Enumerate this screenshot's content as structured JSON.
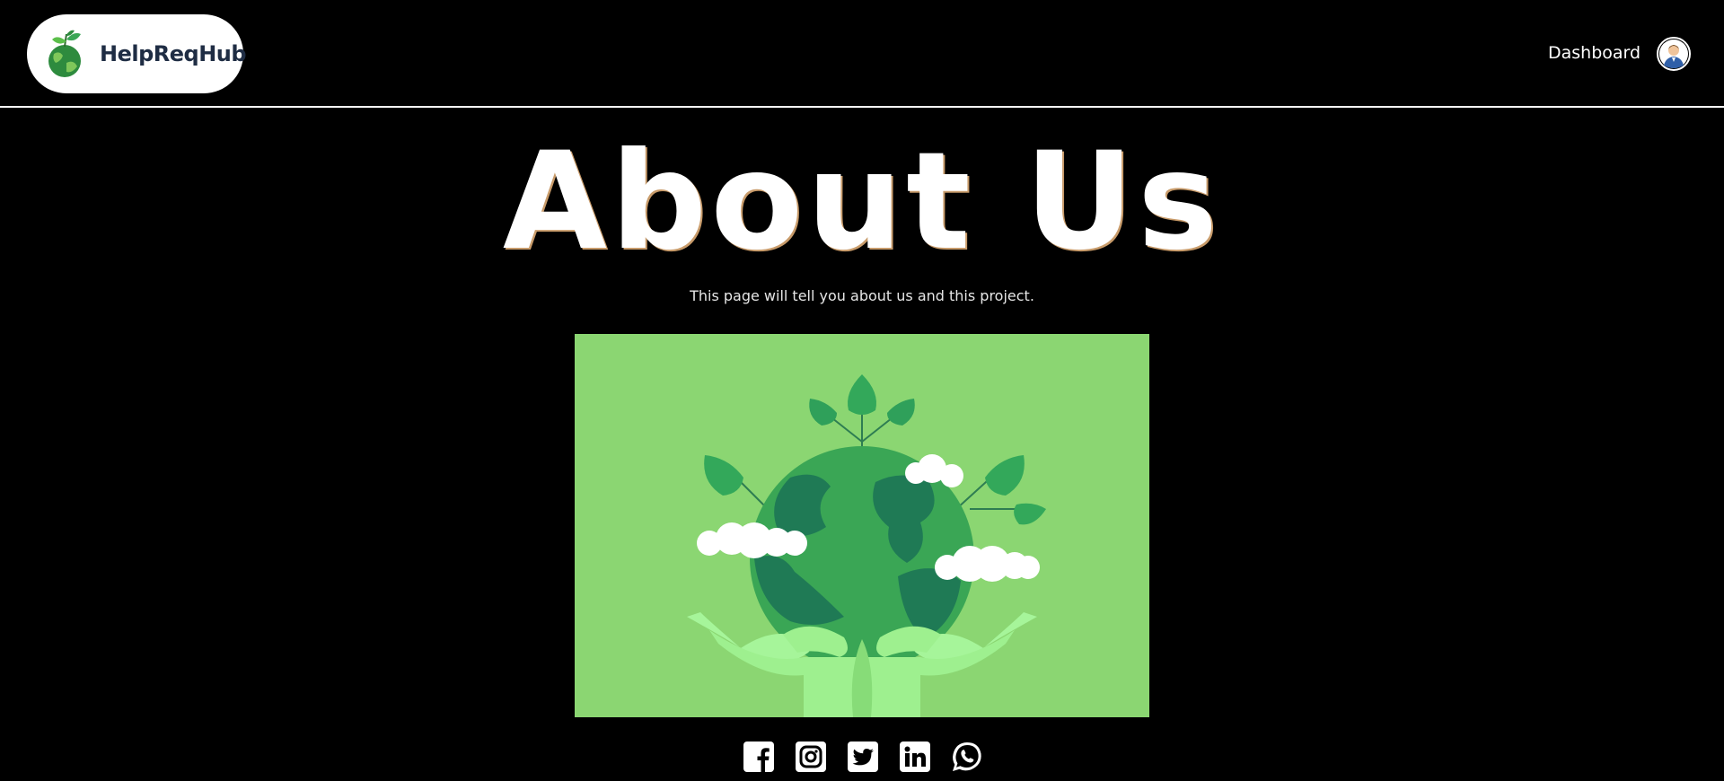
{
  "header": {
    "brand_name": "HelpReqHub",
    "logo_icon": "earth-sprout-icon",
    "nav_dashboard": "Dashboard",
    "avatar_icon": "user-avatar-icon"
  },
  "hero": {
    "title": "About Us",
    "subtitle": "This page will tell you about us and this project."
  },
  "illustration": {
    "icon": "globe-held-by-hands-with-leaves-icon",
    "background_color": "#8bd672"
  },
  "socials": [
    {
      "icon": "facebook-icon"
    },
    {
      "icon": "instagram-icon"
    },
    {
      "icon": "twitter-icon"
    },
    {
      "icon": "linkedin-icon"
    },
    {
      "icon": "whatsapp-icon"
    }
  ],
  "colors": {
    "background": "#000000",
    "brand_text": "#1f2d44",
    "accent_green": "#3aa655"
  }
}
